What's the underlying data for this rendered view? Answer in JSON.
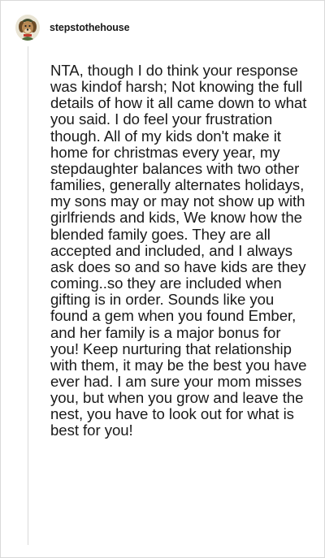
{
  "post": {
    "username": "stepstothehouse",
    "avatar_icon": "dog-avatar-icon",
    "body": "NTA, though I do think your response was kindof harsh; Not knowing the full details of how it all came down to what you said. I do feel your frustration though. All of my kids don't make it home for christmas every year, my stepdaughter balances with two other families, generally alternates holidays, my sons may or may not show up with girlfriends and kids, We know how the blended family goes. They are all accepted and included, and I always ask does so and so have kids are they coming..so they are included when gifting is in order. Sounds like you found a gem when you found Ember, and her family is a major bonus for you! Keep nurturing that relationship with them, it may be the best you have ever had. I am sure your mom misses you, but when you grow and leave the nest, you have to look out for what is best for you!"
  },
  "colors": {
    "text": "#1a1a1a",
    "thread_line": "#dadada",
    "border": "#d9d9d9"
  }
}
